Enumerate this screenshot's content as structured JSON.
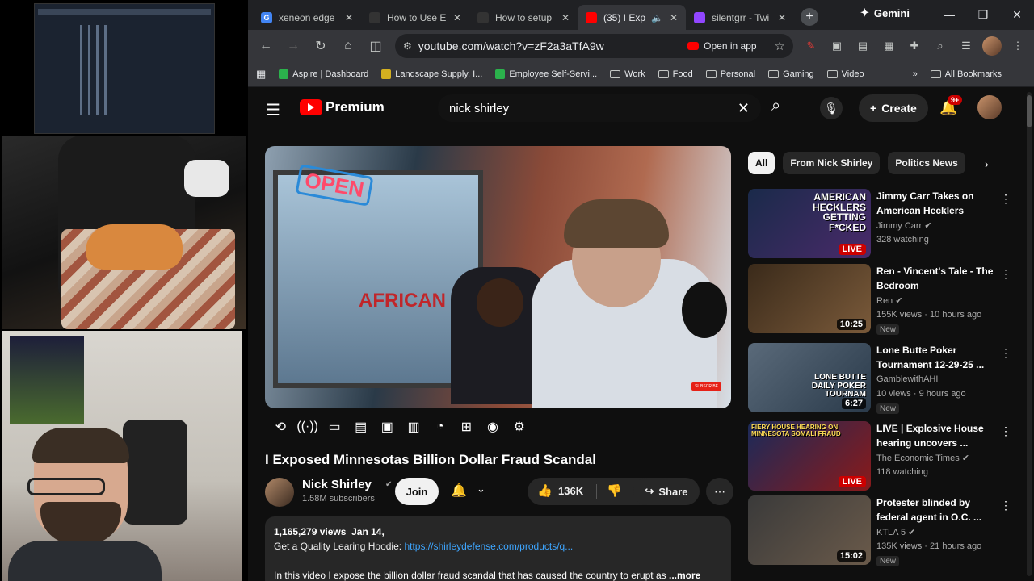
{
  "browser": {
    "tabs": [
      {
        "title": "xeneon edge g",
        "favicon": "G",
        "favicon_color": "#4285f4"
      },
      {
        "title": "How to Use El",
        "favicon": "",
        "favicon_color": "#333333"
      },
      {
        "title": "How to setup",
        "favicon": "",
        "favicon_color": "#333333"
      },
      {
        "title": "(35) I Expo",
        "favicon": "",
        "favicon_color": "#ff0000",
        "active": true
      },
      {
        "title": "silentgrr - Twi",
        "favicon": "",
        "favicon_color": "#9146ff"
      }
    ],
    "gemini_label": "Gemini",
    "url": "youtube.com/watch?v=zF2a3aTfA9w",
    "open_in_app": "Open in app",
    "bookmarks": [
      {
        "label": "Aspire | Dashboard",
        "type": "site",
        "color": "#2bb24c"
      },
      {
        "label": "Landscape Supply, I...",
        "type": "site",
        "color": "#d4b020"
      },
      {
        "label": "Employee Self-Servi...",
        "type": "site",
        "color": "#2bb24c"
      },
      {
        "label": "Work",
        "type": "folder"
      },
      {
        "label": "Food",
        "type": "folder"
      },
      {
        "label": "Personal",
        "type": "folder"
      },
      {
        "label": "Gaming",
        "type": "folder"
      },
      {
        "label": "Video",
        "type": "folder"
      }
    ],
    "all_bookmarks": "All Bookmarks"
  },
  "youtube": {
    "logo_text": "Premium",
    "search_query": "nick shirley",
    "create_label": "Create",
    "notif_badge": "9+",
    "video": {
      "title": "I Exposed Minnesotas Billion Dollar Fraud Scandal",
      "overlay_open": "OPEN",
      "overlay_market": "AFRICAN MARKET",
      "channel": "Nick Shirley",
      "subscribers": "1.58M subscribers",
      "join_label": "Join",
      "likes": "136K",
      "share_label": "Share",
      "views": "1,165,279 views",
      "date": "Jan 14,",
      "desc_prefix": "Get a Quality Learing Hoodie:",
      "desc_link": "https://shirleydefense.com/products/q...",
      "desc_line": "In this video I expose the billion dollar fraud scandal that has caused the country to erupt as",
      "more_label": "...more"
    },
    "chips": [
      {
        "label": "All",
        "active": true
      },
      {
        "label": "From Nick Shirley",
        "active": false
      },
      {
        "label": "Politics News",
        "active": false
      }
    ],
    "recommendations": [
      {
        "title": "Jimmy Carr Takes on American Hecklers",
        "channel": "Jimmy Carr",
        "verified": true,
        "meta": "328 watching",
        "badge": "LIVE",
        "overlay": "AMERICAN HECKLERS GETTING F*CKED",
        "new": false,
        "bg": "linear-gradient(135deg,#1a2a4a,#4a2a6a)"
      },
      {
        "title": "Ren - Vincent's Tale - The Bedroom",
        "channel": "Ren",
        "verified": true,
        "meta": "155K views · 10 hours ago",
        "badge": "10:25",
        "overlay": "",
        "new": true,
        "new_label": "New",
        "bg": "linear-gradient(135deg,#3a2a1a,#7a5a3a)"
      },
      {
        "title": "Lone Butte Poker Tournament 12-29-25 ...",
        "channel": "GamblewithAHI",
        "verified": false,
        "meta": "10 views · 9 hours ago",
        "badge": "6:27",
        "overlay": "LONE BUTTE DAILY POKER TOURNAM",
        "new": true,
        "new_label": "New",
        "bg": "linear-gradient(135deg,#5a6a7a,#2a3a4a)"
      },
      {
        "title": "LIVE | Explosive House hearing uncovers ...",
        "channel": "The Economic Times",
        "verified": true,
        "meta": "118 watching",
        "badge": "LIVE",
        "overlay": "FIERY HOUSE HEARING ON MINNESOTA SOMALI FRAUD",
        "new": false,
        "bg": "linear-gradient(135deg,#1a2a5a,#8a1a1a)"
      },
      {
        "title": "Protester blinded by federal agent in O.C. ...",
        "channel": "KTLA 5",
        "verified": true,
        "meta": "135K views · 21 hours ago",
        "badge": "15:02",
        "overlay": "",
        "new": true,
        "new_label": "New",
        "bg": "linear-gradient(135deg,#3a3a3a,#6a5a4a)"
      }
    ]
  }
}
